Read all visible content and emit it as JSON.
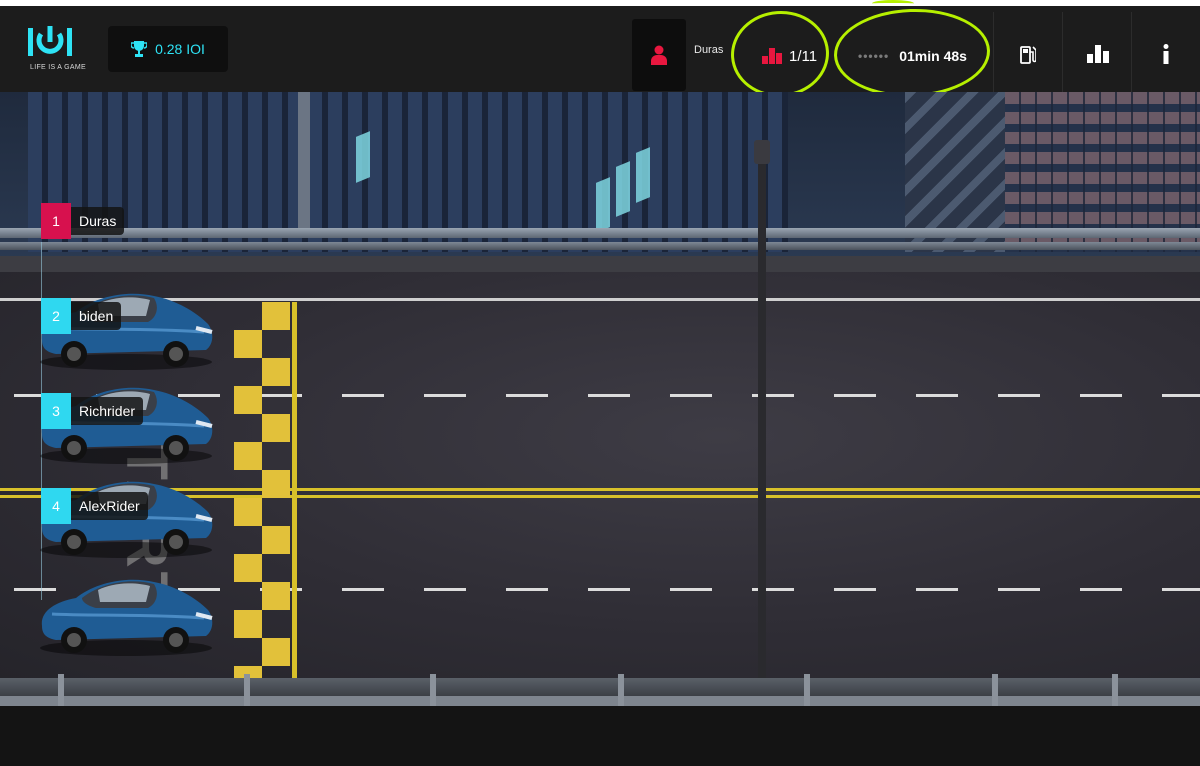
{
  "header": {
    "logo_text": "IOI",
    "logo_tagline": "LIFE IS A GAME",
    "balance": "0.28 IOI",
    "user_name": "Duras",
    "rank": "1/11",
    "timer": "01min 48s",
    "timer_dots": "••••••"
  },
  "icons": {
    "balance": "trophy-icon",
    "user": "user-icon",
    "rank": "podium-icon",
    "fuel": "fuel-icon",
    "leaderboard": "leaderboard-icon",
    "info": "info-icon"
  },
  "scene": {
    "start_text": "START"
  },
  "race": [
    {
      "position": "1",
      "name": "Duras",
      "color": "#d7114e",
      "has_car": false
    },
    {
      "position": "2",
      "name": "biden",
      "color": "#2fd8f0",
      "has_car": true
    },
    {
      "position": "3",
      "name": "Richrider",
      "color": "#2fd8f0",
      "has_car": true
    },
    {
      "position": "4",
      "name": "AlexRider",
      "color": "#2fd8f0",
      "has_car": true
    }
  ],
  "colors": {
    "accent_cyan": "#2ee3f5",
    "accent_red": "#d7114e",
    "annotation_green": "#b6f000",
    "topbar_bg": "#1c1c1c"
  }
}
